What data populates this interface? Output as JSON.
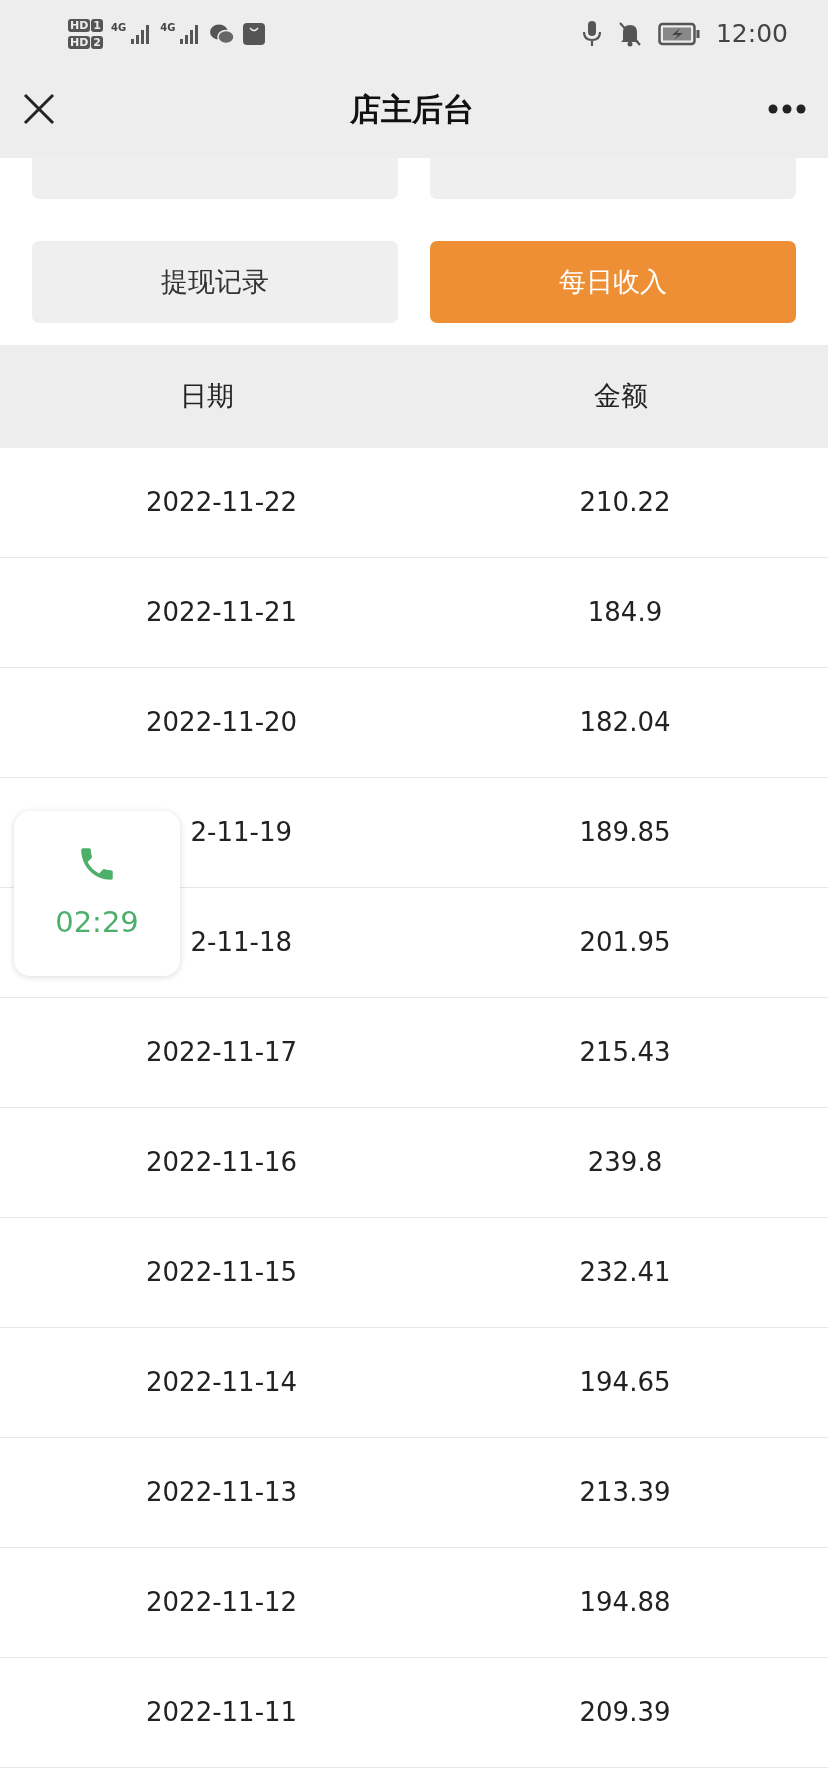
{
  "status_bar": {
    "sims": [
      {
        "label": "HD",
        "slot": "1"
      },
      {
        "label": "HD",
        "slot": "2"
      }
    ],
    "networks": [
      "4G",
      "4G"
    ],
    "time": "12:00"
  },
  "header": {
    "title": "店主后台"
  },
  "covered_buttons": [
    {
      "selected": false
    },
    {
      "selected": false
    }
  ],
  "buttons": [
    {
      "label": "提现记录",
      "selected": false
    },
    {
      "label": "每日收入",
      "selected": true
    }
  ],
  "table": {
    "columns": [
      "日期",
      "金额"
    ],
    "rows": [
      {
        "date": "2022-11-22",
        "amount": "210.22"
      },
      {
        "date": "2022-11-21",
        "amount": "184.9"
      },
      {
        "date": "2022-11-20",
        "amount": "182.04"
      },
      {
        "date": "2-11-19",
        "amount": "189.85"
      },
      {
        "date": "2-11-18",
        "amount": "201.95"
      },
      {
        "date": "2022-11-17",
        "amount": "215.43"
      },
      {
        "date": "2022-11-16",
        "amount": "239.8"
      },
      {
        "date": "2022-11-15",
        "amount": "232.41"
      },
      {
        "date": "2022-11-14",
        "amount": "194.65"
      },
      {
        "date": "2022-11-13",
        "amount": "213.39"
      },
      {
        "date": "2022-11-12",
        "amount": "194.88"
      },
      {
        "date": "2022-11-11",
        "amount": "209.39"
      }
    ]
  },
  "call_widget": {
    "duration": "02:29"
  }
}
